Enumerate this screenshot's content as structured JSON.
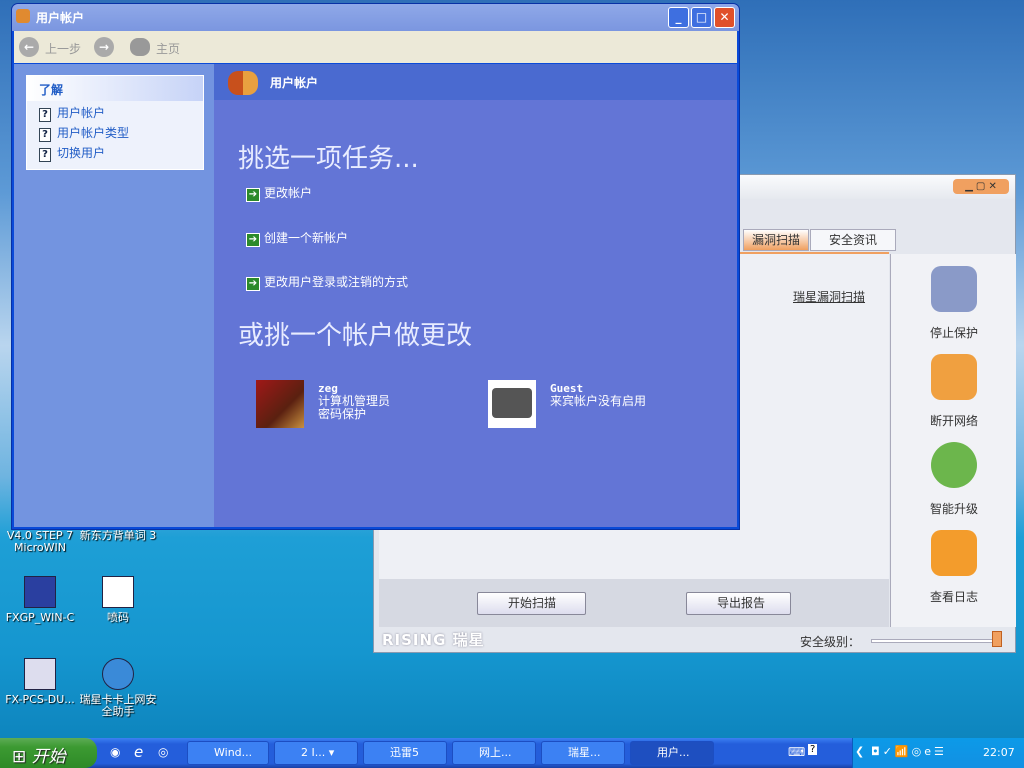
{
  "desktop": {
    "icons": [
      {
        "label": "V4.0 STEP 7 MicroWIN"
      },
      {
        "label": "新东方背单词 3"
      },
      {
        "label": "FXGP_WIN-C"
      },
      {
        "label": "喷码"
      },
      {
        "label": "FX-PCS-DU..."
      },
      {
        "label": "瑞星卡卡上网安全助手"
      }
    ]
  },
  "user_accounts": {
    "title": "用户帐户",
    "toolbar": {
      "back": "上一步",
      "home": "主页"
    },
    "learn": {
      "title": "了解",
      "items": [
        "用户帐户",
        "用户帐户类型",
        "切换用户"
      ]
    },
    "header": "用户帐户",
    "pick_task": "挑选一项任务...",
    "tasks": [
      "更改帐户",
      "创建一个新帐户",
      "更改用户登录或注销的方式"
    ],
    "pick_account": "或挑一个帐户做更改",
    "accounts": [
      {
        "name": "zeg",
        "lines": [
          "计算机管理员",
          "密码保护"
        ]
      },
      {
        "name": "Guest",
        "lines": [
          "来宾帐户没有启用"
        ]
      }
    ]
  },
  "rising": {
    "tabs": [
      "漏洞扫描",
      "安全资讯"
    ],
    "link": "瑞星漏洞扫描",
    "side": [
      "停止保护",
      "断开网络",
      "智能升级",
      "查看日志"
    ],
    "buttons": {
      "scan": "开始扫描",
      "export": "导出报告"
    },
    "brand": "RISING 瑞星",
    "level_label": "安全级别：",
    "level_value": 1.0
  },
  "taskbar": {
    "start": "开始",
    "items": [
      "Wind...",
      "2 I...",
      "迅雷5",
      "网上...",
      "瑞星...",
      "用户..."
    ],
    "clock": "22:07"
  }
}
